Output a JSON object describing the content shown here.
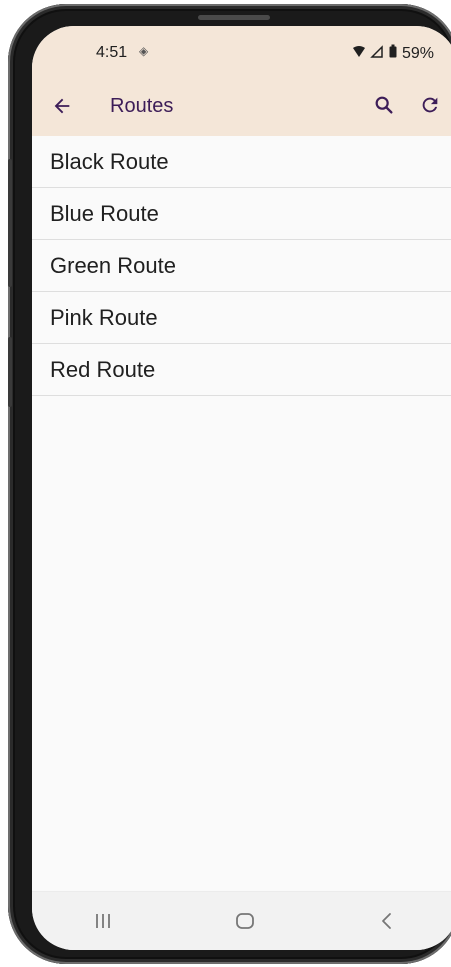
{
  "status": {
    "time": "4:51",
    "left_icon": "location-icon",
    "battery": "59%",
    "wifi_icon": "wifi-icon",
    "signal_icon": "signal-icon",
    "battery_icon": "battery-icon"
  },
  "appbar": {
    "title": "Routes",
    "back_icon": "back-arrow-icon",
    "search_icon": "search-icon",
    "refresh_icon": "refresh-icon"
  },
  "routes": [
    {
      "label": "Black Route"
    },
    {
      "label": "Blue Route"
    },
    {
      "label": "Green Route"
    },
    {
      "label": "Pink Route"
    },
    {
      "label": "Red Route"
    }
  ],
  "navigation": {
    "recents_icon": "recent-apps-icon",
    "home_icon": "home-icon",
    "back_icon": "back-icon"
  },
  "colors": {
    "appbar_bg": "#f4e6d8",
    "accent": "#3d1d58",
    "divider": "#dedede",
    "screen_bg": "#fafafa"
  }
}
